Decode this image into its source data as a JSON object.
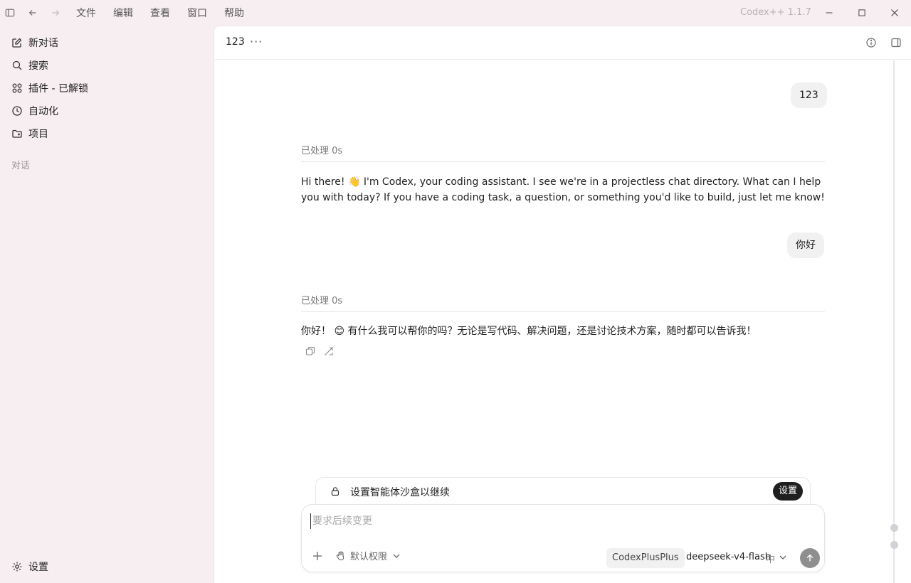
{
  "titlebar": {
    "menu": [
      "文件",
      "编辑",
      "查看",
      "窗口",
      "帮助"
    ],
    "app_version": "Codex++ 1.1.7"
  },
  "sidebar": {
    "items": [
      {
        "label": "新对话",
        "icon": "edit-icon"
      },
      {
        "label": "搜索",
        "icon": "search-icon"
      },
      {
        "label": "插件 - 已解锁",
        "icon": "grid-icon"
      },
      {
        "label": "自动化",
        "icon": "clock-icon"
      },
      {
        "label": "项目",
        "icon": "folder-icon"
      }
    ],
    "section_label": "对话",
    "settings_label": "设置"
  },
  "header": {
    "title": "123",
    "more": "···"
  },
  "messages": [
    {
      "role": "user",
      "text": "123"
    },
    {
      "role": "assistant",
      "status": "已处理 0s",
      "text": "Hi there! 👋 I'm Codex, your coding assistant. I see we're in a projectless chat directory. What can I help you with today? If you have a coding task, a question, or something you'd like to build, just let me know!"
    },
    {
      "role": "user",
      "text": "你好"
    },
    {
      "role": "assistant",
      "status": "已处理 0s",
      "text": "你好！ 😊 有什么我可以帮你的吗？无论是写代码、解决问题，还是讨论技术方案，随时都可以告诉我！"
    }
  ],
  "banner": {
    "text": "设置智能体沙盒以继续",
    "button": "设置"
  },
  "composer": {
    "placeholder": "要求后续变更",
    "permission": "默认权限",
    "chip": "CodexPlusPlus",
    "model": "deepseek-v4-flash",
    "effort": "中"
  }
}
